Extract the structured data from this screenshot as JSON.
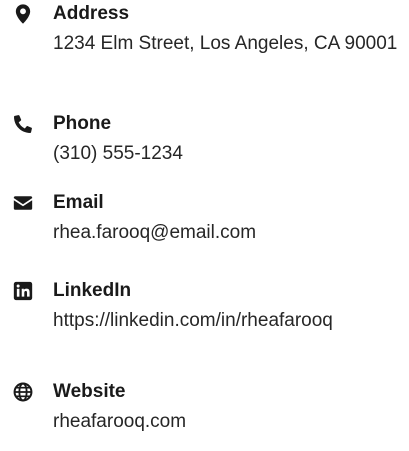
{
  "contacts": {
    "address": {
      "icon": "map-pin-icon",
      "label": "Address",
      "value": "1234 Elm Street, Los Angeles, CA 90001"
    },
    "phone": {
      "icon": "phone-icon",
      "label": "Phone",
      "value": "(310) 555-1234"
    },
    "email": {
      "icon": "envelope-icon",
      "label": "Email",
      "value": "rhea.farooq@email.com"
    },
    "linkedin": {
      "icon": "linkedin-icon",
      "label": "LinkedIn",
      "value": "https://linkedin.com/in/rheafarooq"
    },
    "website": {
      "icon": "globe-icon",
      "label": "Website",
      "value": "rheafarooq.com"
    }
  },
  "colors": {
    "icon": "#1a1a1a",
    "label": "#1a1a1a",
    "text": "#262626"
  }
}
